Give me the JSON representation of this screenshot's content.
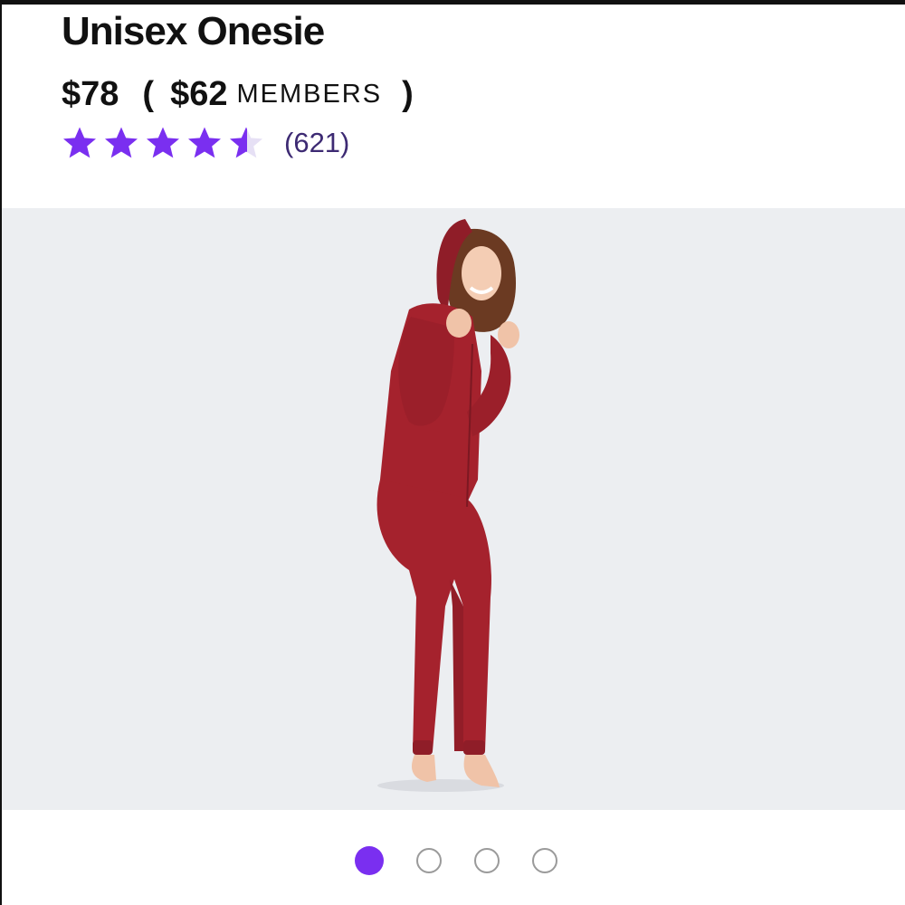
{
  "product": {
    "title": "Unisex Onesie",
    "price": "$78",
    "paren_open": "(",
    "member_price": "$62",
    "members_label": "MEMBERS",
    "paren_close": ")"
  },
  "rating": {
    "value": 4.5,
    "max": 5,
    "review_count": "(621)",
    "star_color": "#7a2ff0"
  },
  "gallery": {
    "image_subject": "model-in-red-hooded-onesie",
    "background_color": "#eceef1",
    "garment_color": "#a5222d",
    "dots": [
      {
        "name": "gallery-dot-1",
        "active": true
      },
      {
        "name": "gallery-dot-2",
        "active": false
      },
      {
        "name": "gallery-dot-3",
        "active": false
      },
      {
        "name": "gallery-dot-4",
        "active": false
      }
    ]
  }
}
